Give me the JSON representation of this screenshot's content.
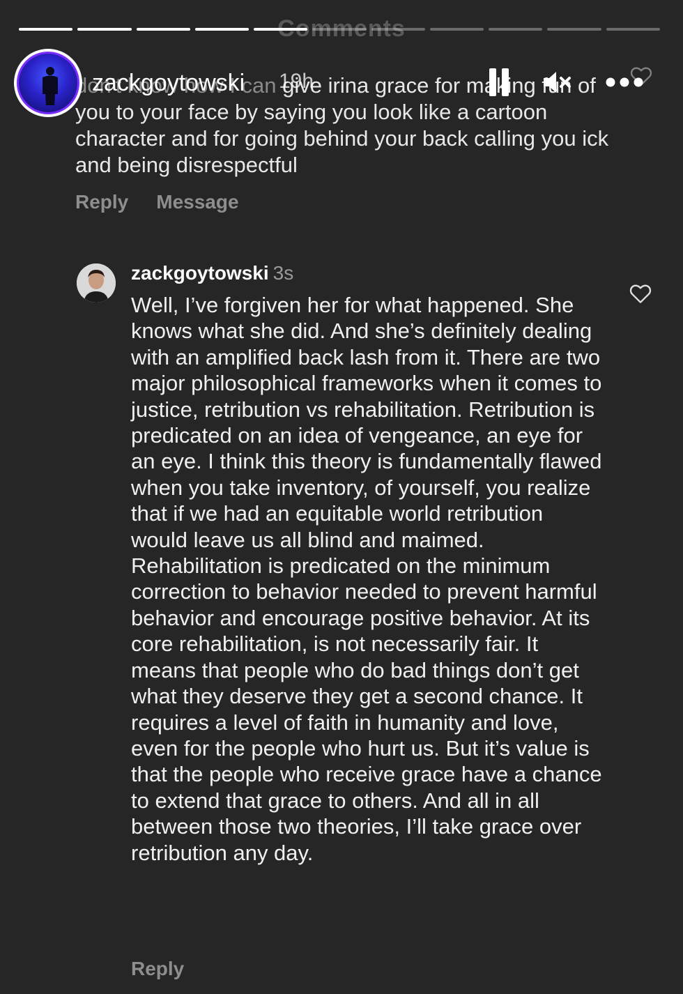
{
  "story": {
    "progress_segments": [
      {
        "state": "done"
      },
      {
        "state": "done"
      },
      {
        "state": "done"
      },
      {
        "state": "done"
      },
      {
        "state": "done"
      },
      {
        "state": "pending"
      },
      {
        "state": "pending"
      },
      {
        "state": "pending"
      },
      {
        "state": "pending"
      },
      {
        "state": "pending"
      },
      {
        "state": "pending"
      }
    ],
    "background_title": "Comments",
    "username": "zackgoytowski",
    "timestamp": "19h",
    "controls": {
      "pause_icon": "pause-icon",
      "mute_icon": "muted-speaker-icon",
      "more_icon": "more-options-icon"
    }
  },
  "comments": [
    {
      "text_lead": "don't know how I can",
      "text": " give irina grace for making fun of you to your face by saying you look like a cartoon character and for going behind your back calling you ick and being disrespectful",
      "actions": {
        "reply": "Reply",
        "message": "Message"
      },
      "like_icon": "heart-outline-icon"
    }
  ],
  "reply": {
    "username": "zackgoytowski",
    "timestamp": "3s",
    "text": "Well, I’ve forgiven her for what happened. She knows what she did. And she’s definitely dealing with an amplified back lash from it. There are two major philosophical frameworks when it comes to justice, retribution vs rehabilitation. Retribution is predicated on an idea of vengeance, an eye for an eye. I think this theory is fundamentally flawed when you take inventory, of yourself, you realize that if we had an equitable world retribution would leave us all blind and maimed. Rehabilitation is predicated on the minimum correction to behavior needed to prevent harmful behavior and encourage positive behavior. At its core rehabilitation, is not necessarily fair. It means that people who do bad things don’t get what they deserve they get a second chance. It requires a level of faith in humanity and love, even for the people who hurt us. But it’s value is that the people who receive grace have a chance to extend that grace to others. And all in all between those two theories, I’ll take grace over retribution any day.",
    "action_reply": "Reply",
    "like_icon": "heart-outline-icon"
  },
  "colors": {
    "background": "#262626",
    "text_primary": "#f0f0f0",
    "text_secondary": "#8e8e8e",
    "progress_done": "#ffffff",
    "avatar_ring": "#7b2cff"
  }
}
